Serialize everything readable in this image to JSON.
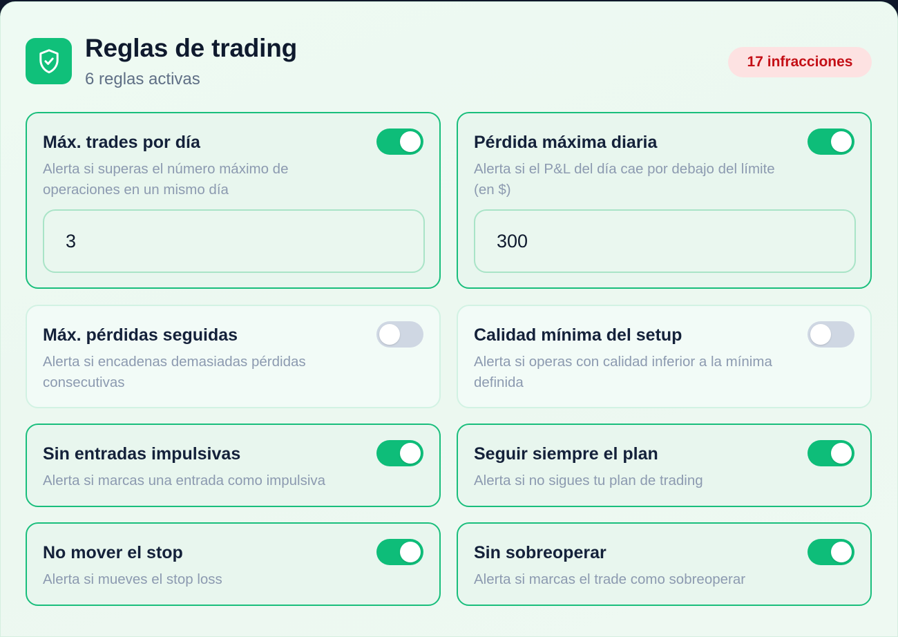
{
  "header": {
    "icon": "shield-check-icon",
    "title": "Reglas de trading",
    "subtitle": "6 reglas activas",
    "badge": "17 infracciones"
  },
  "colors": {
    "accent": "#10c07a",
    "badge_bg": "#fde2e2",
    "badge_text": "#c40f16",
    "toggle_off": "#cfd7e3"
  },
  "rules": [
    {
      "title": "Máx. trades por día",
      "description": "Alerta si superas el número máximo de operaciones en un mismo día",
      "enabled": true,
      "value": "3"
    },
    {
      "title": "Pérdida máxima diaria",
      "description": "Alerta si el P&L del día cae por debajo del límite (en $)",
      "enabled": true,
      "value": "300"
    },
    {
      "title": "Máx. pérdidas seguidas",
      "description": "Alerta si encadenas demasiadas pérdidas consecutivas",
      "enabled": false
    },
    {
      "title": "Calidad mínima del setup",
      "description": "Alerta si operas con calidad inferior a la mínima definida",
      "enabled": false
    },
    {
      "title": "Sin entradas impulsivas",
      "description": "Alerta si marcas una entrada como impulsiva",
      "enabled": true
    },
    {
      "title": "Seguir siempre el plan",
      "description": "Alerta si no sigues tu plan de trading",
      "enabled": true
    },
    {
      "title": "No mover el stop",
      "description": "Alerta si mueves el stop loss",
      "enabled": true
    },
    {
      "title": "Sin sobreoperar",
      "description": "Alerta si marcas el trade como sobreoperar",
      "enabled": true
    }
  ]
}
